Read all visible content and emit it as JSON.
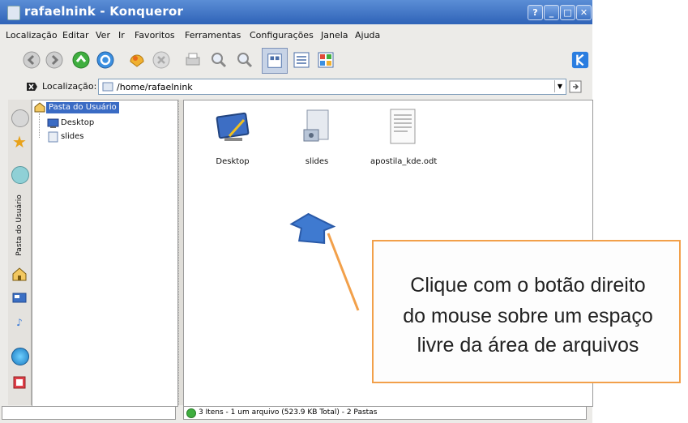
{
  "window": {
    "title": "rafaelnink - Konqueror",
    "buttons": [
      "?",
      "_",
      "□",
      "✕"
    ]
  },
  "menubar": {
    "items": [
      "Localização",
      "Editar",
      "Ver",
      "Ir",
      "Favoritos",
      "Ferramentas",
      "Configurações",
      "Janela",
      "Ajuda"
    ]
  },
  "location": {
    "label": "Localização:",
    "value": "/home/rafaelnink"
  },
  "sidebar": {
    "tab_label": "Pasta do Usuário"
  },
  "tree": {
    "root": "Pasta do Usuário",
    "items": [
      "Desktop",
      "slides"
    ]
  },
  "files": [
    {
      "name": "Desktop"
    },
    {
      "name": "slides"
    },
    {
      "name": "apostila_kde.odt"
    }
  ],
  "status": {
    "text": "3 Itens - 1 um arquivo (523.9 KB Total) - 2 Pastas"
  },
  "callout": {
    "lines": [
      "Clique com o botão direito",
      "do mouse sobre um espaço",
      "livre da área de arquivos"
    ],
    "border_color": "#f2a04a"
  }
}
